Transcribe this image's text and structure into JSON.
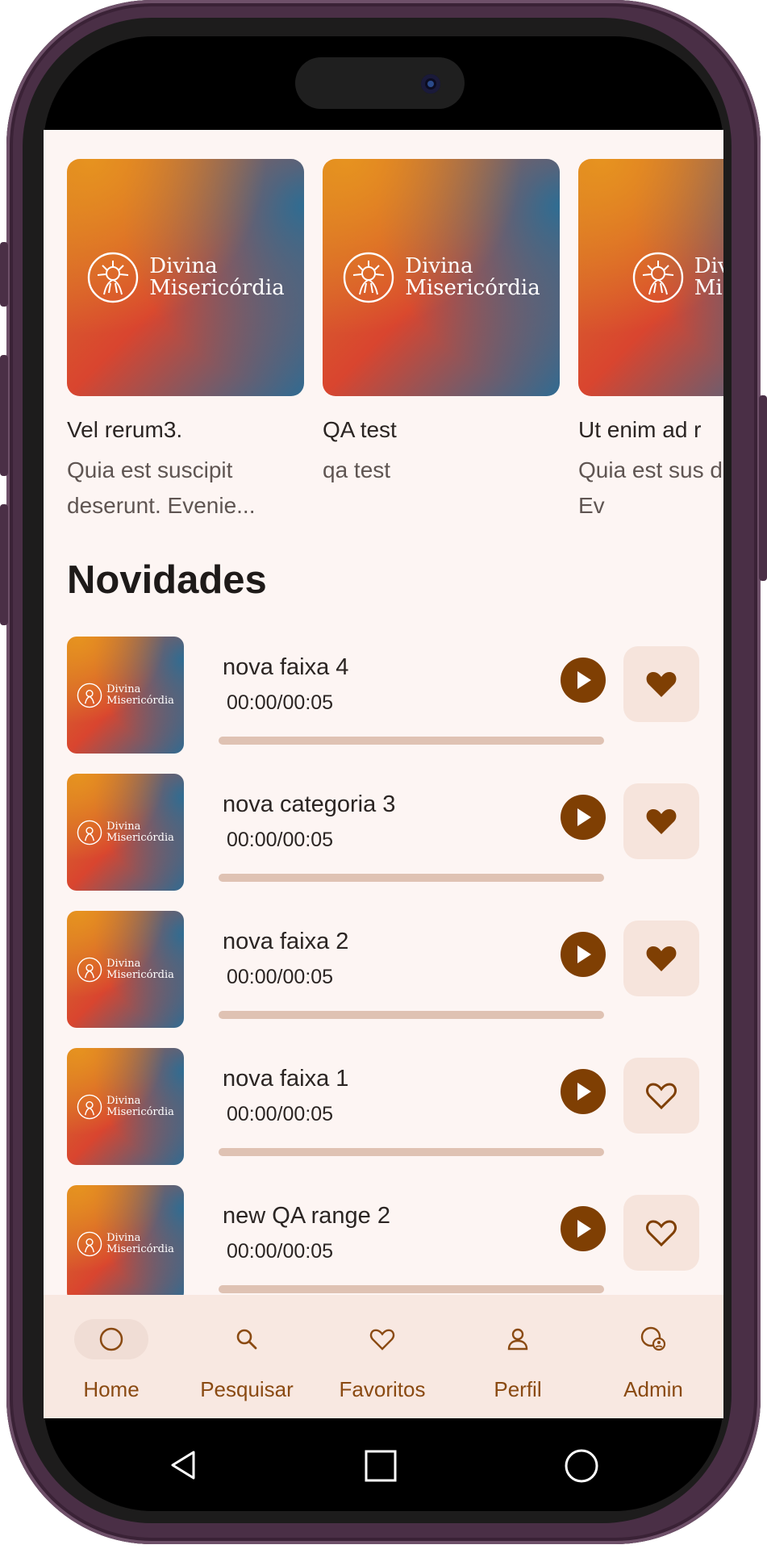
{
  "carousel": {
    "cards": [
      {
        "title": "Vel rerum3.",
        "description": "Quia est suscipit deserunt. Evenie...",
        "logo_line1": "Divina",
        "logo_line2": "Misericórdia"
      },
      {
        "title": "QA test",
        "description": "qa test",
        "logo_line1": "Divina",
        "logo_line2": "Misericórdia"
      },
      {
        "title": "Ut enim ad r",
        "description": "Quia est sus deserunt. Ev",
        "logo_line1": "Divina",
        "logo_line2": "Miser"
      }
    ]
  },
  "novidades": {
    "title": "Novidades",
    "tracks": [
      {
        "title": "nova faixa 4",
        "time": "00:00/00:05",
        "progress": 0,
        "favorited": true,
        "logo_line1": "Divina",
        "logo_line2": "Misericórdia"
      },
      {
        "title": "nova categoria 3",
        "time": "00:00/00:05",
        "progress": 0,
        "favorited": true,
        "logo_line1": "Divina",
        "logo_line2": "Misericórdia"
      },
      {
        "title": "nova faixa 2",
        "time": "00:00/00:05",
        "progress": 0,
        "favorited": true,
        "logo_line1": "Divina",
        "logo_line2": "Misericórdia"
      },
      {
        "title": "nova faixa 1",
        "time": "00:00/00:05",
        "progress": 0,
        "favorited": false,
        "logo_line1": "Divina",
        "logo_line2": "Misericórdia"
      },
      {
        "title": "new QA range 2",
        "time": "00:00/00:05",
        "progress": 0,
        "favorited": false,
        "logo_line1": "Divina",
        "logo_line2": "Misericórdia"
      }
    ]
  },
  "bottom_nav": {
    "items": [
      {
        "label": "Home",
        "icon": "home-icon",
        "active": true
      },
      {
        "label": "Pesquisar",
        "icon": "search-icon",
        "active": false
      },
      {
        "label": "Favoritos",
        "icon": "heart-icon",
        "active": false
      },
      {
        "label": "Perfil",
        "icon": "person-icon",
        "active": false
      },
      {
        "label": "Admin",
        "icon": "admin-icon",
        "active": false
      }
    ]
  },
  "colors": {
    "accent": "#7f3f03",
    "background": "#fdf5f3",
    "nav_background": "#f8e8e1",
    "progress_track": "#dfc2b3",
    "fav_button_bg": "#f6e4dc"
  }
}
